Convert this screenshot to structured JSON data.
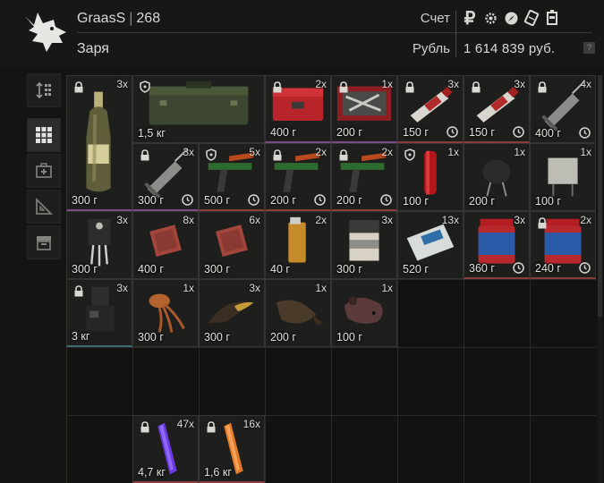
{
  "header": {
    "player_name": "GraasS",
    "player_level": "268",
    "faction": "Заря",
    "account_label": "Счет",
    "currency_label": "Рубль",
    "money": "1 614 839 руб.",
    "help": "?",
    "currency_icons": [
      "ruble-icon",
      "gear-icon",
      "compass-icon",
      "ticket-icon",
      "device-icon"
    ]
  },
  "tools": [
    "sort-icon",
    "grid-view-icon",
    "medkit-category-icon",
    "ruler-category-icon",
    "box-category-icon"
  ],
  "items": [
    {
      "id": "champagne",
      "count": "3x",
      "weight": "300 г",
      "badge": "lock",
      "timer": false
    },
    {
      "id": "military-case",
      "count": "",
      "weight": "1,5 кг",
      "badge": "shield",
      "timer": false
    },
    {
      "id": "red-toolbox",
      "count": "2x",
      "weight": "400 г",
      "badge": "lock",
      "timer": false
    },
    {
      "id": "repair-kit",
      "count": "1x",
      "weight": "200 г",
      "badge": "lock",
      "timer": false
    },
    {
      "id": "tube-1",
      "count": "3x",
      "weight": "150 г",
      "badge": "lock",
      "timer": true
    },
    {
      "id": "tube-2",
      "count": "3x",
      "weight": "150 г",
      "badge": "lock",
      "timer": true
    },
    {
      "id": "syringe-1",
      "count": "4x",
      "weight": "400 г",
      "badge": "lock",
      "timer": true
    },
    {
      "id": "syringe-2",
      "count": "3x",
      "weight": "300 г",
      "badge": "lock",
      "timer": true
    },
    {
      "id": "dart-gun-1",
      "count": "5x",
      "weight": "500 г",
      "badge": "shield",
      "timer": true
    },
    {
      "id": "dart-gun-2",
      "count": "2x",
      "weight": "200 г",
      "badge": "lock",
      "timer": true
    },
    {
      "id": "dart-gun-3",
      "count": "2x",
      "weight": "200 г",
      "badge": "lock",
      "timer": true
    },
    {
      "id": "red-cylinder",
      "count": "1x",
      "weight": "100 г",
      "badge": "shield",
      "timer": false
    },
    {
      "id": "capacitor",
      "count": "1x",
      "weight": "200 г",
      "badge": "",
      "timer": false
    },
    {
      "id": "relay",
      "count": "1x",
      "weight": "100 г",
      "badge": "",
      "timer": false
    },
    {
      "id": "transistor",
      "count": "3x",
      "weight": "300 г",
      "badge": "",
      "timer": false
    },
    {
      "id": "chip-1",
      "count": "8x",
      "weight": "400 г",
      "badge": "",
      "timer": false
    },
    {
      "id": "chip-2",
      "count": "6x",
      "weight": "300 г",
      "badge": "",
      "timer": false
    },
    {
      "id": "lighter",
      "count": "2x",
      "weight": "40 г",
      "badge": "",
      "timer": false
    },
    {
      "id": "cigarettes",
      "count": "3x",
      "weight": "300 г",
      "badge": "",
      "timer": false
    },
    {
      "id": "bandage",
      "count": "13x",
      "weight": "520 г",
      "badge": "",
      "timer": false
    },
    {
      "id": "jar-1",
      "count": "3x",
      "weight": "360 г",
      "badge": "",
      "timer": true
    },
    {
      "id": "jar-2",
      "count": "2x",
      "weight": "240 г",
      "badge": "lock",
      "timer": true
    },
    {
      "id": "device",
      "count": "3x",
      "weight": "3 кг",
      "badge": "lock",
      "timer": false
    },
    {
      "id": "squid",
      "count": "1x",
      "weight": "300 г",
      "badge": "",
      "timer": false
    },
    {
      "id": "horn",
      "count": "3x",
      "weight": "300 г",
      "badge": "",
      "timer": false
    },
    {
      "id": "fish",
      "count": "1x",
      "weight": "200 г",
      "badge": "",
      "timer": false
    },
    {
      "id": "rat-head",
      "count": "1x",
      "weight": "100 г",
      "badge": "",
      "timer": false
    },
    {
      "id": "glowstick-purple",
      "count": "47x",
      "weight": "4,7 кг",
      "badge": "lock",
      "timer": false
    },
    {
      "id": "glowstick-orange",
      "count": "16x",
      "weight": "1,6 кг",
      "badge": "lock",
      "timer": false
    }
  ]
}
